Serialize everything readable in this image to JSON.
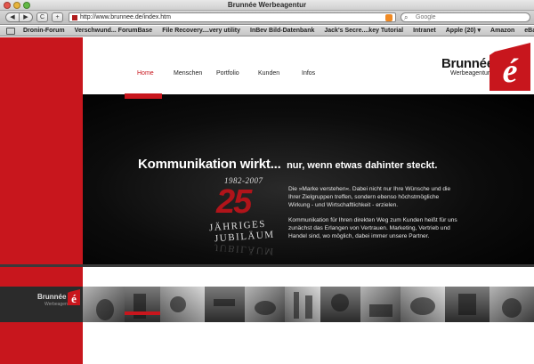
{
  "browser": {
    "window_title": "Brunnée Werbeagentur",
    "url": "http://www.brunnee.de/index.htm",
    "search_placeholder": "Google",
    "bookmarks": [
      "Dronin-Forum",
      "Verschwund... ForumBase",
      "File Recovery....very utility",
      "InBev Bild-Datenbank",
      "Jack's Secre....key Tutorial",
      "Intranet",
      "Apple (20) ▾",
      "Amazon",
      "eBay"
    ],
    "nav_buttons": {
      "back": "◀",
      "forward": "▶",
      "reload": "C",
      "add": "+"
    }
  },
  "site": {
    "nav": [
      {
        "label": "Home",
        "active": true
      },
      {
        "label": "Menschen",
        "active": false
      },
      {
        "label": "Portfolio",
        "active": false
      },
      {
        "label": "Kunden",
        "active": false
      },
      {
        "label": "Infos",
        "active": false
      }
    ],
    "logo": {
      "name": "Brunnée",
      "sub": "Werbeagentur",
      "mark": "é"
    },
    "headline_main": "Kommunikation wirkt...",
    "headline_rest": "nur, wenn etwas dahinter steckt.",
    "jubilee": {
      "years": "1982-2007",
      "number": "25",
      "line1": "JÄHRIGES",
      "line2": "JUBILÄUM"
    },
    "paragraphs": [
      "Die »Marke verstehen«. Dabei nicht nur Ihre Wünsche und die Ihrer Zielgruppen treffen, sondern ebenso höchstmögliche Wirkung - und Wirtschaftlichkeit - erzielen.",
      "Kommunikation für Ihren direkten Weg zum Kunden heißt für uns zunächst das Erlangen von Vertrauen. Marketing, Vertrieb und Handel sind, wo möglich, dabei immer unsere Partner."
    ],
    "strip_logo": {
      "name": "Brunnée",
      "sub": "Werbeagentur",
      "mark": "é"
    }
  },
  "colors": {
    "brand_red": "#c8161d",
    "dark": "#000000"
  }
}
